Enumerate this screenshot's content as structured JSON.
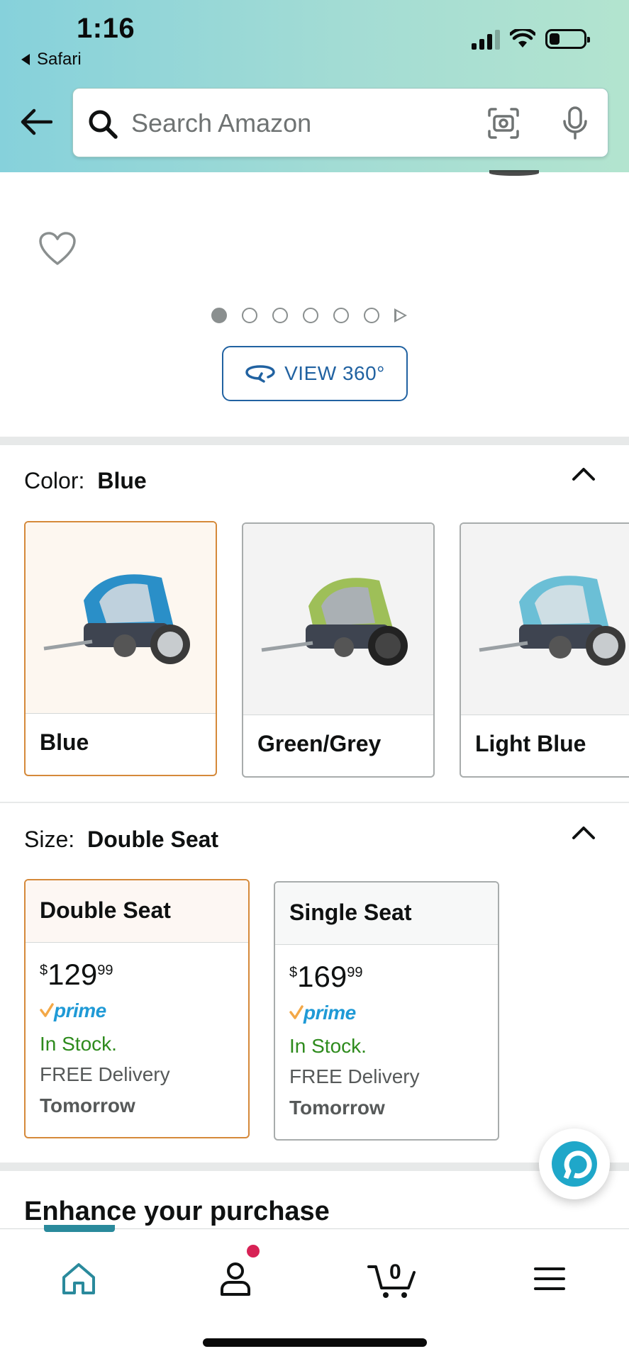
{
  "status_bar": {
    "time": "1:16",
    "back_app": "Safari"
  },
  "search": {
    "placeholder": "Search Amazon"
  },
  "carousel": {
    "dot_count": 6,
    "active_dot": 1,
    "view360_label": "VIEW 360°"
  },
  "color": {
    "label": "Color:",
    "selected": "Blue",
    "options": [
      {
        "name": "Blue",
        "accent": "#2a8fc8"
      },
      {
        "name": "Green/Grey",
        "accent": "#9ebf58"
      },
      {
        "name": "Light Blue",
        "accent": "#6bbfd6"
      }
    ]
  },
  "size": {
    "label": "Size:",
    "selected": "Double Seat",
    "options": [
      {
        "name": "Double Seat",
        "currency": "$",
        "price_whole": "129",
        "price_fraction": "99",
        "prime": "prime",
        "stock": "In Stock.",
        "delivery": "FREE Delivery",
        "delivery_day": "Tomorrow"
      },
      {
        "name": "Single Seat",
        "currency": "$",
        "price_whole": "169",
        "price_fraction": "99",
        "prime": "prime",
        "stock": "In Stock.",
        "delivery": "FREE Delivery",
        "delivery_day": "Tomorrow"
      }
    ]
  },
  "section_heading": "Enhance your purchase",
  "cart_count": "0",
  "colors": {
    "selected_border": "#d5893a",
    "link_blue": "#2162a1",
    "in_stock_green": "#2e8b1d",
    "prime_blue": "#1f9ad6",
    "prime_check": "#f3a847",
    "home_tab_teal": "#2a8a9c",
    "notification_dot": "#d72255"
  },
  "tabs": [
    "home-icon",
    "account-icon",
    "cart-icon",
    "menu-icon"
  ]
}
